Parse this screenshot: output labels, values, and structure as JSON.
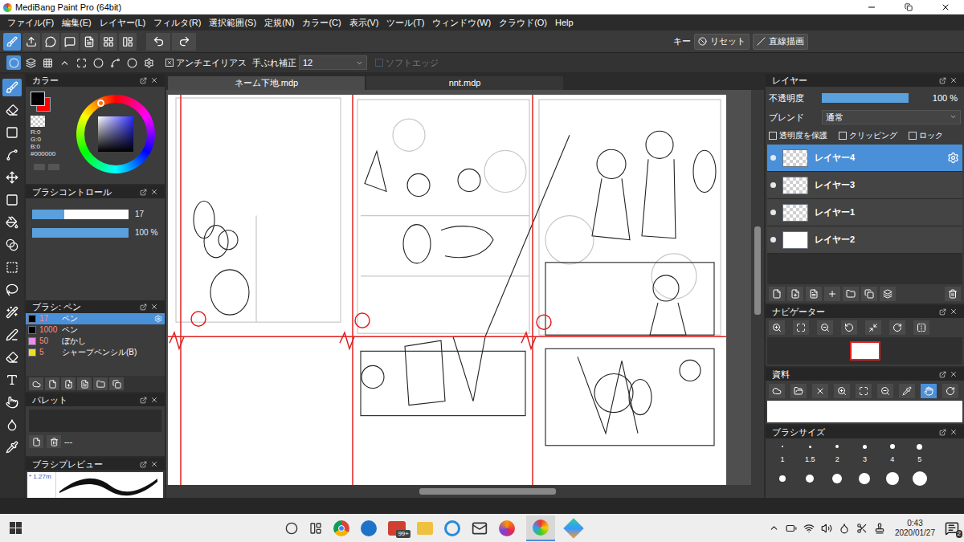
{
  "window": {
    "title": "MediBang Paint Pro (64bit)"
  },
  "menu": [
    "ファイル(F)",
    "編集(E)",
    "レイヤー(L)",
    "フィルタ(R)",
    "選択範囲(S)",
    "定規(N)",
    "カラー(C)",
    "表示(V)",
    "ツール(T)",
    "ウィンドウ(W)",
    "クラウド(O)",
    "Help"
  ],
  "toolbar": {
    "key_label": "キー",
    "reset": "リセット",
    "straight_line": "直線描画"
  },
  "brush_options": {
    "antialias": {
      "label": "アンチエイリアス",
      "checked": true
    },
    "stabilizer": {
      "label": "手ぶれ補正",
      "value": "12"
    },
    "soft_edge": {
      "label": "ソフトエッジ",
      "checked": false,
      "disabled": true
    }
  },
  "tools": [
    {
      "selected": true
    },
    {
      "selected": false
    },
    {
      "selected": false
    },
    {
      "selected": false
    },
    {
      "selected": false
    },
    {
      "selected": false
    },
    {
      "selected": false
    },
    {
      "selected": false
    },
    {
      "selected": false
    },
    {
      "selected": false
    },
    {
      "selected": false
    },
    {
      "selected": false
    },
    {
      "selected": false
    },
    {
      "selected": false
    },
    {
      "selected": false
    },
    {
      "selected": false
    },
    {
      "selected": false
    }
  ],
  "color_panel": {
    "title": "カラー",
    "readings": [
      "R:0",
      "G:0",
      "B:0"
    ],
    "hex": "#000000",
    "foreground": "#000000",
    "background": "#ff0000"
  },
  "brush_control": {
    "title": "ブラシコントロール",
    "sliders": [
      {
        "value": "17",
        "level": 0.33
      },
      {
        "value": "100 %",
        "level": 1
      }
    ]
  },
  "brush_panel": {
    "title": "ブラシ: ペン",
    "brushes": [
      {
        "size": "17",
        "name": "ペン",
        "color": "#000000",
        "selected": true
      },
      {
        "size": "1000",
        "name": "ペン",
        "color": "#000000",
        "selected": false
      },
      {
        "size": "50",
        "name": "ぼかし",
        "color": "#f08ce6",
        "selected": false
      },
      {
        "size": "5",
        "name": "シャープペンシル(B)",
        "color": "#f0e020",
        "selected": false
      }
    ]
  },
  "palette": {
    "title": "パレット",
    "entry": "---"
  },
  "brush_preview": {
    "title": "ブラシプレビュー",
    "size": "* 1.27m"
  },
  "tabs": [
    {
      "label": "ネーム下地.mdp",
      "selected": true
    },
    {
      "label": "nnt.mdp",
      "selected": false
    }
  ],
  "layers_panel": {
    "title": "レイヤー",
    "opacity": {
      "label": "不透明度",
      "value": "100 %",
      "level": 1
    },
    "blend": {
      "label": "ブレンド",
      "value": "通常"
    },
    "options": [
      {
        "label": "透明度を保護",
        "checked": false
      },
      {
        "label": "クリッピング",
        "checked": false
      },
      {
        "label": "ロック",
        "checked": false
      }
    ],
    "layers": [
      {
        "name": "レイヤー4",
        "selected": true,
        "visible": true,
        "kind": "transparent"
      },
      {
        "name": "レイヤー3",
        "selected": false,
        "visible": true,
        "kind": "transparent"
      },
      {
        "name": "レイヤー1",
        "selected": false,
        "visible": true,
        "kind": "transparent"
      },
      {
        "name": "レイヤー2",
        "selected": false,
        "visible": true,
        "kind": "white"
      }
    ]
  },
  "navigator": {
    "title": "ナビゲーター"
  },
  "materials": {
    "title": "資料"
  },
  "brush_sizes": {
    "title": "ブラシサイズ",
    "sizes": [
      "1",
      "1.5",
      "2",
      "3",
      "4",
      "5"
    ]
  },
  "taskbar": {
    "mail_badge": "99+",
    "time": "0:43",
    "date": "2020/01/27",
    "notifications": "2"
  }
}
